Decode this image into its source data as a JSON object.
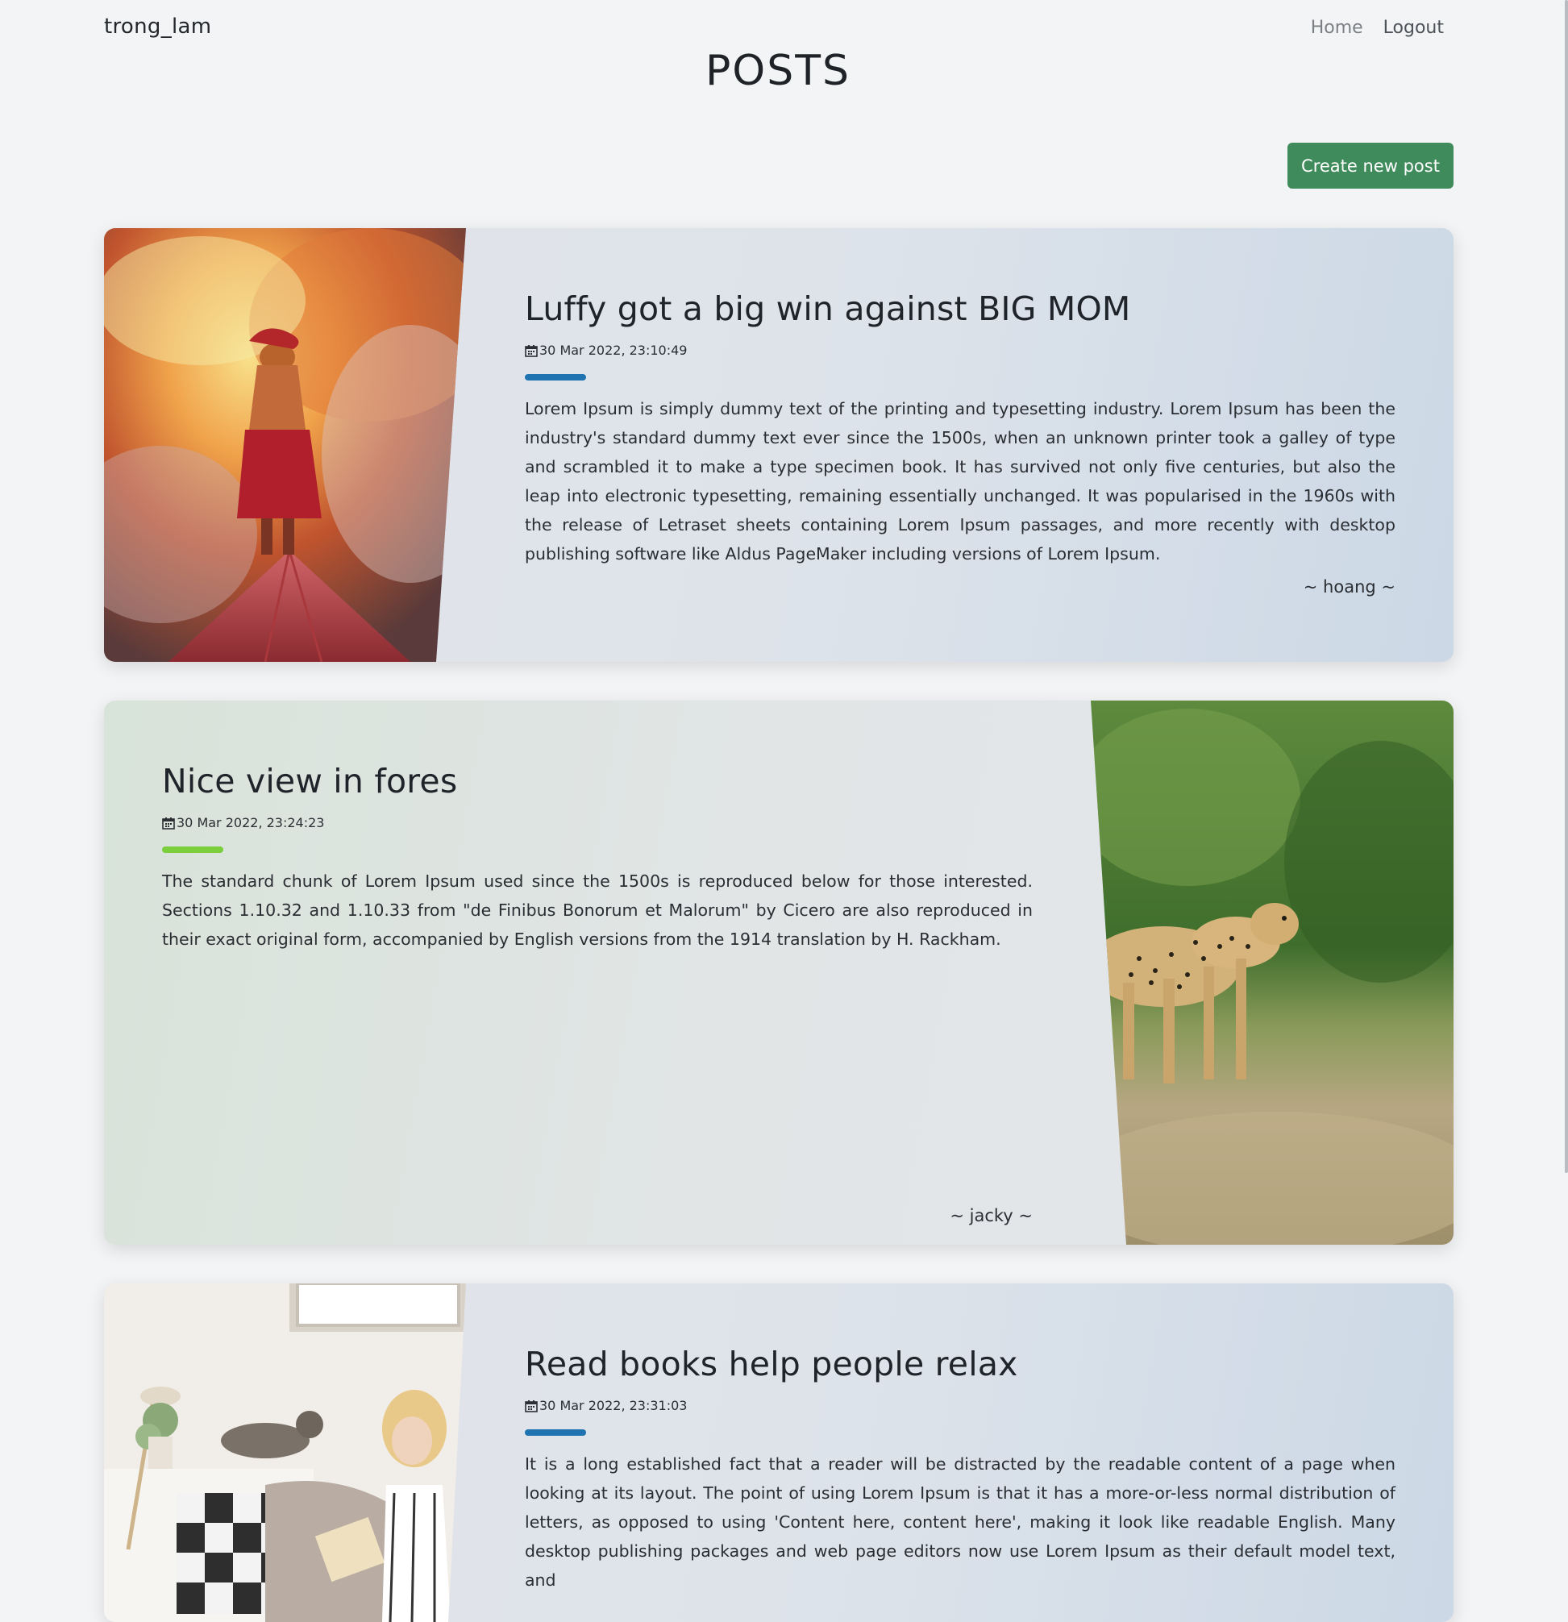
{
  "navbar": {
    "brand": "trong_lam",
    "links": [
      {
        "label": "Home"
      },
      {
        "label": "Logout"
      }
    ]
  },
  "page": {
    "title": "POSTS",
    "create_button": "Create new post"
  },
  "posts": [
    {
      "title": "Luffy got a big win against BIG MOM",
      "date": "30 Mar 2022, 23:10:49",
      "body": "Lorem Ipsum is simply dummy text of the printing and typesetting industry. Lorem Ipsum has been the industry's standard dummy text ever since the 1500s, when an unknown printer took a galley of type and scrambled it to make a type specimen book. It has survived not only five centuries, but also the leap into electronic typesetting, remaining essentially unchanged. It was popularised in the 1960s with the release of Letraset sheets containing Lorem Ipsum passages, and more recently with desktop publishing software like Aldus PageMaker including versions of Lorem Ipsum.",
      "author": "~ hoang ~",
      "accent_color": "#1f73b0",
      "image": "anime-warrior-image",
      "image_side": "left"
    },
    {
      "title": "Nice view in fores",
      "date": "30 Mar 2022, 23:24:23",
      "body": "The standard chunk of Lorem Ipsum used since the 1500s is reproduced below for those interested. Sections 1.10.32 and 1.10.33 from \"de Finibus Bonorum et Malorum\" by Cicero are also reproduced in their exact original form, accompanied by English versions from the 1914 translation by H. Rackham.",
      "author": "~ jacky ~",
      "accent_color": "#7ccf3c",
      "image": "cheetah-image",
      "image_side": "right"
    },
    {
      "title": "Read books help people relax",
      "date": "30 Mar 2022, 23:31:03",
      "body": "It is a long established fact that a reader will be distracted by the readable content of a page when looking at its layout. The point of using Lorem Ipsum is that it has a more-or-less normal distribution of letters, as opposed to using 'Content here, content here', making it look like readable English. Many desktop publishing packages and web page editors now use Lorem Ipsum as their default model text, and",
      "author": "",
      "accent_color": "#1f73b0",
      "image": "reading-woman-image",
      "image_side": "left"
    }
  ]
}
